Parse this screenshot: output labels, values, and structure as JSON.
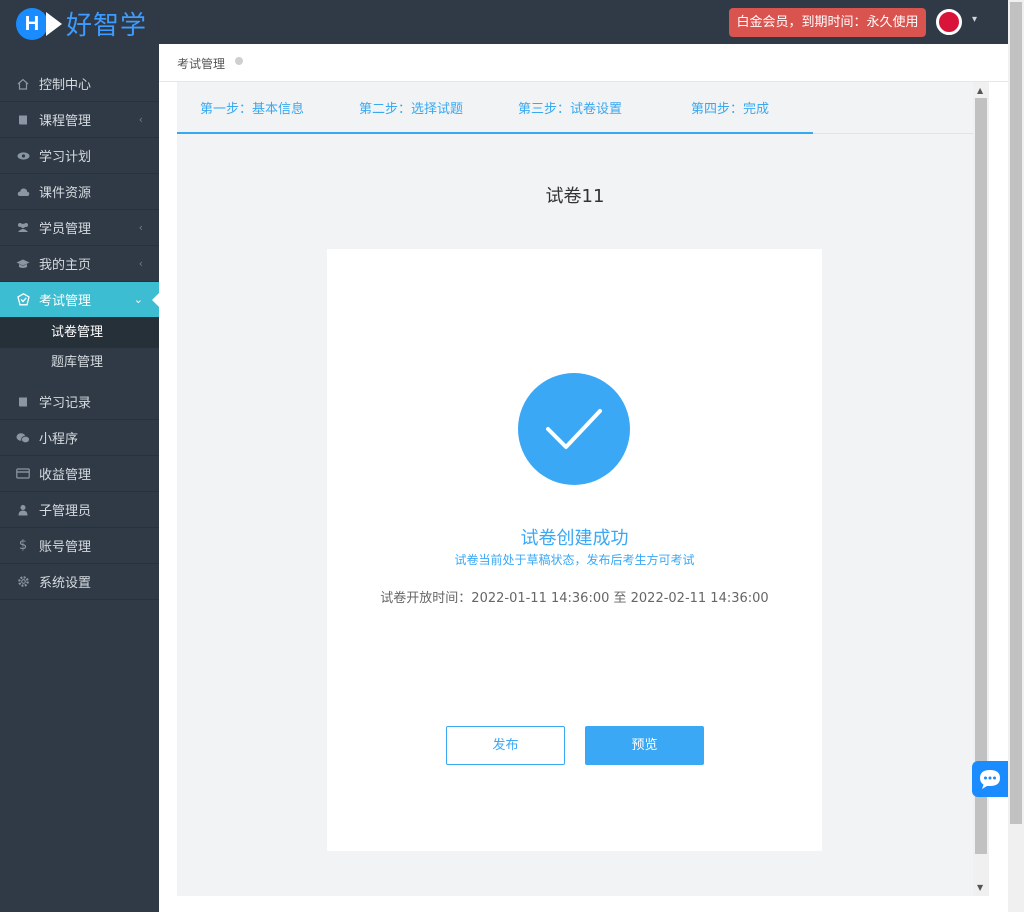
{
  "header": {
    "logo_letter": "H",
    "logo_text": "好智学",
    "membership_badge": "白金会员，到期时间：永久使用",
    "avatar_color": "#d8143a"
  },
  "sidebar": {
    "items": [
      {
        "label": "控制中心",
        "icon": "home-icon",
        "has_chevron": false
      },
      {
        "label": "课程管理",
        "icon": "book-icon",
        "has_chevron": true
      },
      {
        "label": "学习计划",
        "icon": "eye-icon",
        "has_chevron": false
      },
      {
        "label": "课件资源",
        "icon": "cloud-icon",
        "has_chevron": false
      },
      {
        "label": "学员管理",
        "icon": "users-icon",
        "has_chevron": true
      },
      {
        "label": "我的主页",
        "icon": "graduation-cap-icon",
        "has_chevron": true
      },
      {
        "label": "考试管理",
        "icon": "badge-check-icon",
        "has_chevron": true,
        "active": true
      },
      {
        "label": "学习记录",
        "icon": "book-icon",
        "has_chevron": false
      },
      {
        "label": "小程序",
        "icon": "wechat-icon",
        "has_chevron": false
      },
      {
        "label": "收益管理",
        "icon": "credit-card-icon",
        "has_chevron": false
      },
      {
        "label": "子管理员",
        "icon": "user-icon",
        "has_chevron": false
      },
      {
        "label": "账号管理",
        "icon": "dollar-icon",
        "has_chevron": false
      },
      {
        "label": "系统设置",
        "icon": "gear-icon",
        "has_chevron": false
      }
    ],
    "sub_items": [
      {
        "label": "试卷管理",
        "current": true
      },
      {
        "label": "题库管理",
        "current": false
      }
    ]
  },
  "breadcrumb": {
    "current": "考试管理"
  },
  "steps": [
    {
      "label": "第一步：基本信息"
    },
    {
      "label": "第二步：选择试题"
    },
    {
      "label": "第三步：试卷设置"
    },
    {
      "label": "第四步：完成"
    }
  ],
  "main": {
    "paper_title": "试卷11",
    "success_title": "试卷创建成功",
    "success_subtitle": "试卷当前处于草稿状态，发布后考生方可考试",
    "open_time": "试卷开放时间：2022-01-11 14:36:00 至 2022-02-11 14:36:00",
    "publish_label": "发布",
    "preview_label": "预览"
  },
  "colors": {
    "primary": "#3aa8f5",
    "sidebar_bg": "#2f3a46",
    "active_item": "#3dbdd1",
    "badge_red": "#d9534f"
  }
}
